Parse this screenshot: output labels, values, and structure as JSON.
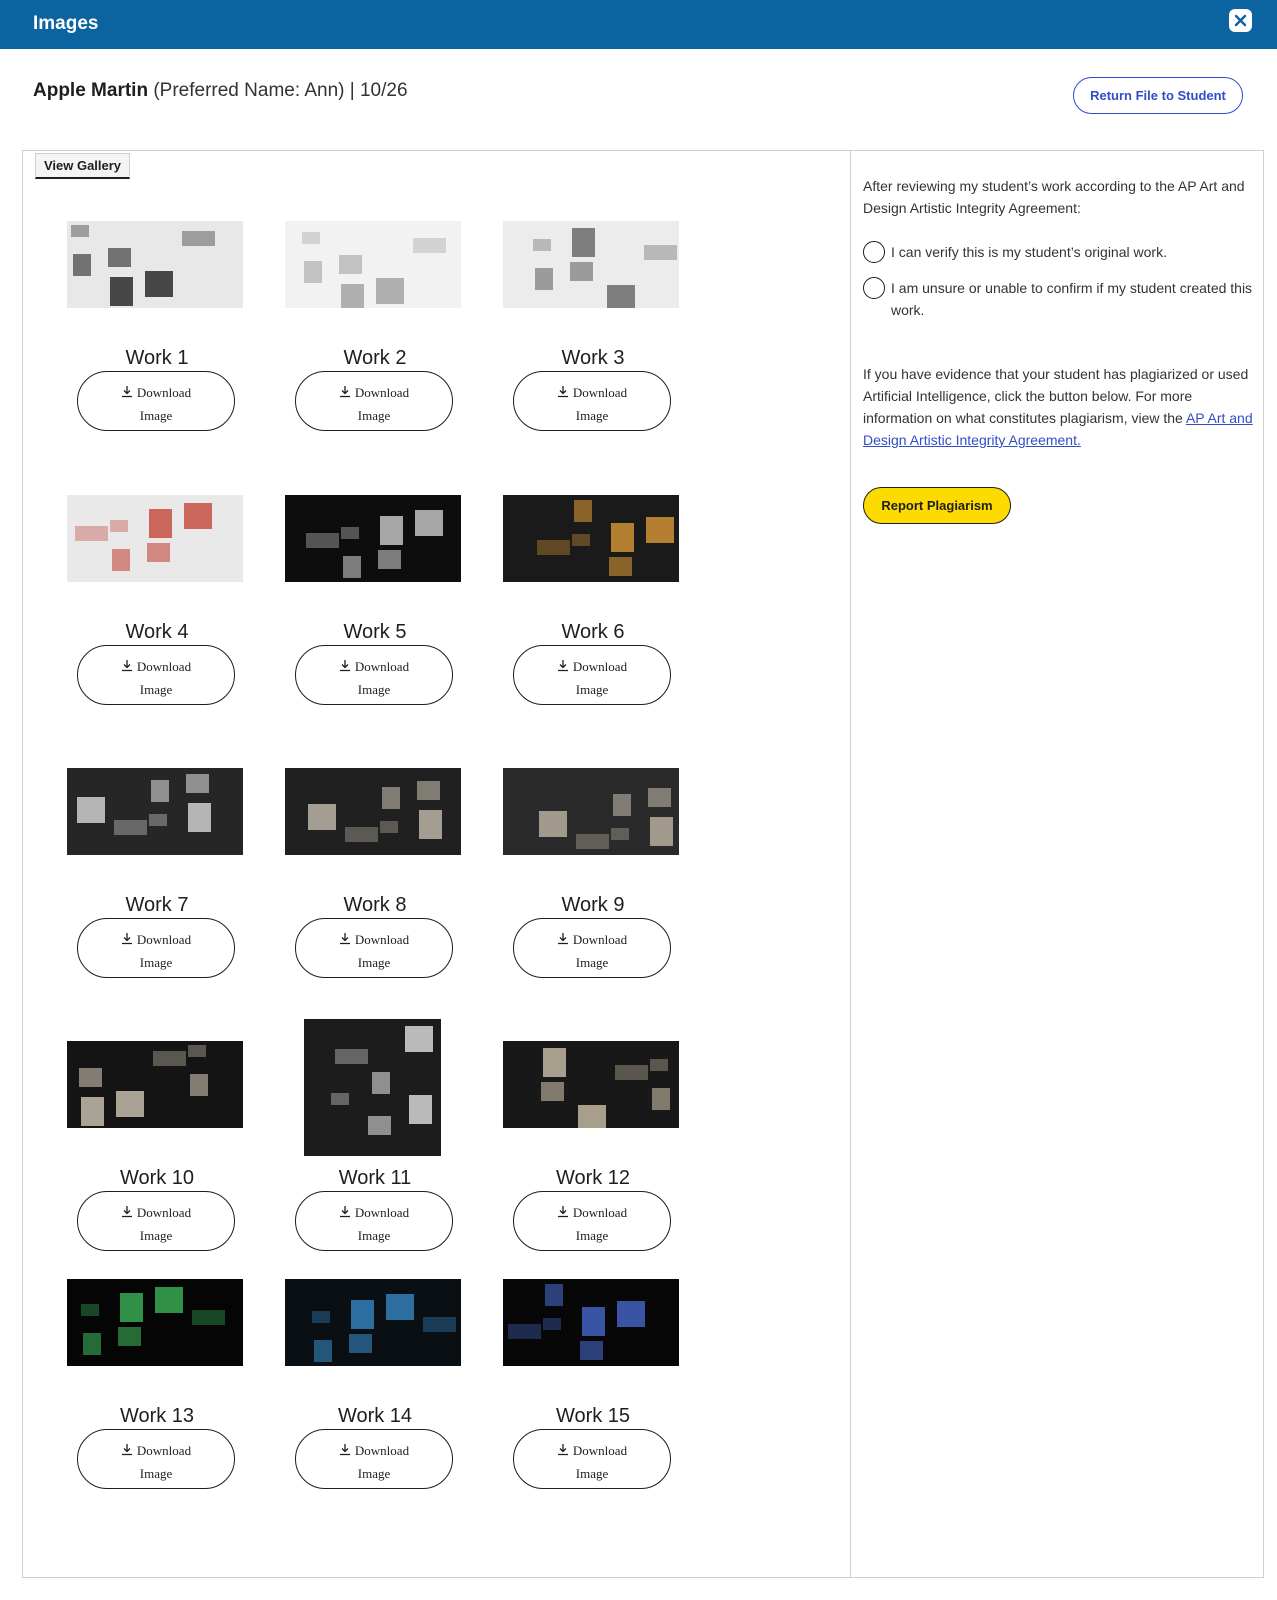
{
  "modal": {
    "title": "Images",
    "close_icon": "close-icon"
  },
  "student": {
    "name": "Apple Martin",
    "details": "(Preferred Name: Ann) | 10/26"
  },
  "actions": {
    "return_label": "Return File to Student"
  },
  "gallery": {
    "tab_label": "View Gallery",
    "download_label_line1": "Download",
    "download_label_line2": "Image",
    "works": [
      {
        "title": "Work 1",
        "thumb_bg": "#e8e8e8",
        "accent": "#111111"
      },
      {
        "title": "Work 2",
        "thumb_bg": "#f2f2f2",
        "accent": "#9a9a9a"
      },
      {
        "title": "Work 3",
        "thumb_bg": "#ececec",
        "accent": "#5a5a5a"
      },
      {
        "title": "Work 4",
        "thumb_bg": "#e9e9e9",
        "accent": "#c0392b"
      },
      {
        "title": "Work 5",
        "thumb_bg": "#0d0d0d",
        "accent": "#d9d9d9"
      },
      {
        "title": "Work 6",
        "thumb_bg": "#1a1a1a",
        "accent": "#e8a13a"
      },
      {
        "title": "Work 7",
        "thumb_bg": "#262626",
        "accent": "#e5e5e5"
      },
      {
        "title": "Work 8",
        "thumb_bg": "#202020",
        "accent": "#cfc7b8"
      },
      {
        "title": "Work 9",
        "thumb_bg": "#2a2a2a",
        "accent": "#c9bfae"
      },
      {
        "title": "Work 10",
        "thumb_bg": "#141414",
        "accent": "#dcd2c0"
      },
      {
        "title": "Work 11",
        "thumb_bg": "#1c1c1c",
        "accent": "#efefef"
      },
      {
        "title": "Work 12",
        "thumb_bg": "#181818",
        "accent": "#d8cbb3"
      },
      {
        "title": "Work 13",
        "thumb_bg": "#050505",
        "accent": "#3fbf5f"
      },
      {
        "title": "Work 14",
        "thumb_bg": "#0a0f14",
        "accent": "#3a8fd0"
      },
      {
        "title": "Work 15",
        "thumb_bg": "#070707",
        "accent": "#4a6fd8"
      }
    ]
  },
  "review": {
    "intro": "After reviewing my student’s work according to the AP Art and Design Artistic Integrity Agreement:",
    "option_verify": "I can verify this is my student’s original work.",
    "option_unsure": "I am unsure or unable to confirm if my student created this work.",
    "evidence_text": "If you have evidence that your student has plagiarized or used Artificial Intelligence, click the button below. For more information on what constitutes plagiarism, view the",
    "agreement_link": "AP Art and Design Artistic Integrity Agreement.",
    "report_label": "Report Plagiarism"
  },
  "colors": {
    "header": "#0b64a0",
    "link": "#324dc7",
    "report": "#fedb00"
  }
}
